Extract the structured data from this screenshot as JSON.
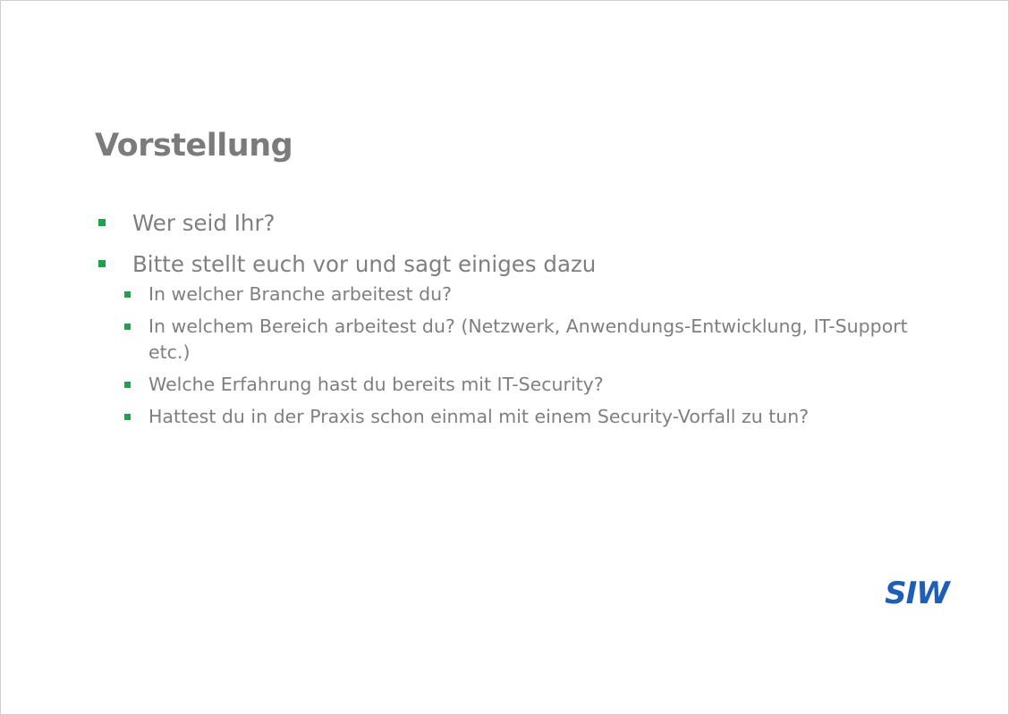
{
  "slide": {
    "title": "Vorstellung",
    "bullets": [
      {
        "text": "Wer seid Ihr?"
      },
      {
        "text": "Bitte stellt euch vor und sagt einiges dazu",
        "sub": [
          "In welcher Branche arbeitest du?",
          "In welchem Bereich arbeitest du? (Netzwerk, Anwendungs-Entwicklung, IT-Support etc.)",
          "Welche Erfahrung hast du bereits mit IT-Security?",
          "Hattest du in der Praxis schon einmal mit einem Security-Vorfall zu tun?"
        ]
      }
    ],
    "logo_text": "SIW",
    "colors": {
      "text": "#7f7f7f",
      "bullet": "#1ea24a",
      "logo": "#1f5fb3"
    },
    "icons": {
      "bullet": "square-bullet-icon",
      "logo": "siw-logo-icon"
    }
  }
}
